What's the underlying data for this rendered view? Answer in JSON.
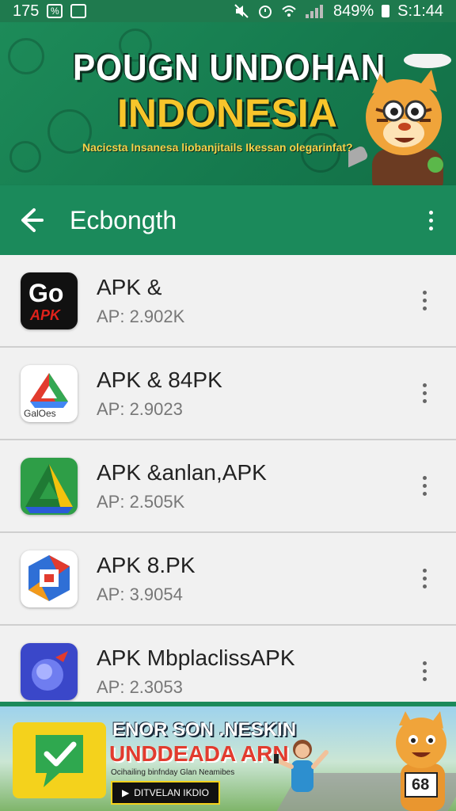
{
  "status_bar": {
    "left_text": "175",
    "battery": "849%",
    "time": "S:1:44"
  },
  "banner": {
    "title_line1": "POUGN UNDOHAN",
    "title_line2": "INDONESIA",
    "tagline": "Nacicsta Insanesa liobanjitails Ikessan olegarinfat?"
  },
  "app_bar": {
    "title": "Ecbongth"
  },
  "apps": [
    {
      "name": "APK &",
      "sub": "AP: 2.902K",
      "icon": "go-apk-icon"
    },
    {
      "name": "APK & 84PK",
      "sub": "AP: 2.9023",
      "icon": "galoes-icon"
    },
    {
      "name": "APK &anlan,APK",
      "sub": "AP: 2.505K",
      "icon": "drive-triangle-icon"
    },
    {
      "name": "APK 8.PK",
      "sub": "AP: 3.9054",
      "icon": "colorful-hex-icon"
    },
    {
      "name": "APK MbplaclissAPK",
      "sub": "AP: 2.3053",
      "icon": "purple-planet-icon"
    }
  ],
  "icon_labels": {
    "go_top": "Go",
    "go_bottom": "APK",
    "galoes": "GalOes"
  },
  "ad": {
    "line1": "ENOR SON .NESKIN",
    "line2": "UNDDEADA ARN",
    "line3": "Ocihailing binfnday Glan Neamibes",
    "button": "DITVELAN IKDIO",
    "bib": "68"
  },
  "colors": {
    "primary": "#1b8a5b",
    "banner_yellow": "#f7c52b"
  }
}
